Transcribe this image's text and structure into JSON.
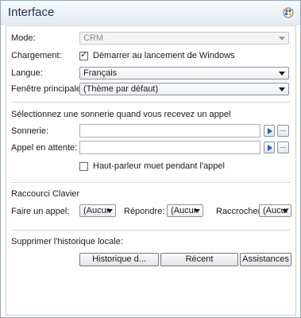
{
  "window": {
    "title": "Interface"
  },
  "general": {
    "mode_label": "Mode:",
    "mode_value": "CRM",
    "loading_label": "Chargement:",
    "startup_checkbox_label": "Démarrer au lancement de Windows",
    "startup_checked": true,
    "language_label": "Langue:",
    "language_value": "Français",
    "main_window_label": "Fenêtre principale:",
    "main_window_value": "(Thème par défaut)"
  },
  "ringtone": {
    "heading": "Sélectionnez une sonnerie quand vous recevez un appel",
    "ringtone_label": "Sonnerie:",
    "ringtone_value": "",
    "waiting_label": "Appel en attente:",
    "waiting_value": "",
    "browse_label": "...",
    "mute_checkbox_label": "Haut-parleur muet pendant l'appel",
    "mute_checked": false
  },
  "shortcuts": {
    "heading": "Raccourci Clavier",
    "make_call_label": "Faire un appel:",
    "make_call_value": "(Aucur",
    "answer_label": "Répondre:",
    "answer_value": "(Aucur",
    "hangup_label": "Raccrocher:",
    "hangup_value": "(Aucur"
  },
  "history": {
    "heading": "Supprimer l'historique locale:",
    "buttons": {
      "history": "Historique d...",
      "recent": "Récent",
      "assistance": "Assistances"
    }
  },
  "colors": {
    "accent": "#1f5bd6",
    "title_text": "#1f2f45"
  },
  "icons": {
    "window": "palette-icon",
    "play": "play-icon"
  }
}
